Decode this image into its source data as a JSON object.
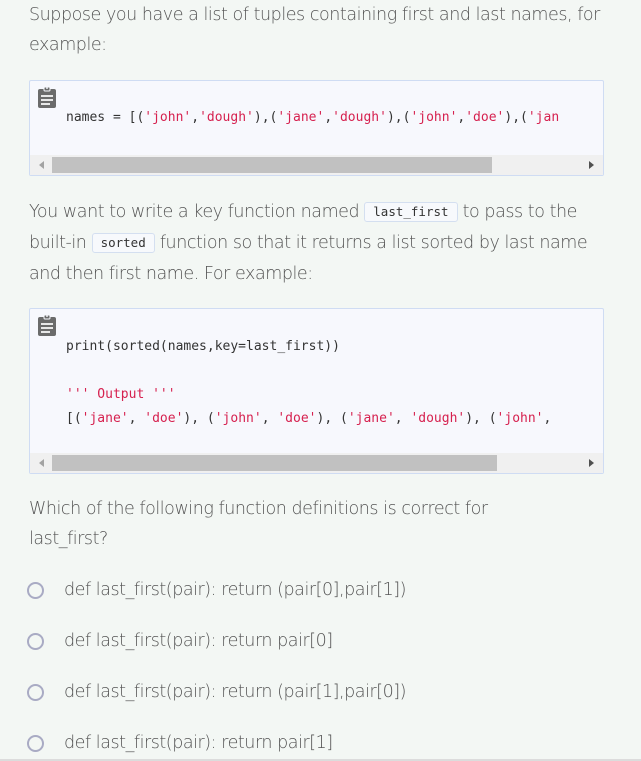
{
  "intro": {
    "text": "Suppose you have a list of tuples containing first and last names, for example:"
  },
  "code_block_1": {
    "icon": "clipboard-icon",
    "line_prefix": "names = [(",
    "tokens": [
      {
        "t": "'john'",
        "s": true
      },
      {
        "t": ",",
        "s": false
      },
      {
        "t": "'dough'",
        "s": true
      },
      {
        "t": "),(",
        "s": false
      },
      {
        "t": "'jane'",
        "s": true
      },
      {
        "t": ",",
        "s": false
      },
      {
        "t": "'dough'",
        "s": true
      },
      {
        "t": "),(",
        "s": false
      },
      {
        "t": "'john'",
        "s": true
      },
      {
        "t": ",",
        "s": false
      },
      {
        "t": "'doe'",
        "s": true
      },
      {
        "t": "),(",
        "s": false
      },
      {
        "t": "'jan",
        "s": true
      }
    ]
  },
  "description": {
    "part1": "You want to write a key function named ",
    "code1": "last_first",
    "part2": " to pass to the built-in ",
    "code2": "sorted",
    "part3": " function so that it returns a list sorted by last name and then first name. For example:"
  },
  "code_block_2": {
    "icon": "clipboard-icon",
    "line1": "print(sorted(names,key=last_first))",
    "line2": "''' Output '''",
    "line3_tokens": [
      {
        "t": "[(",
        "s": false
      },
      {
        "t": "'jane'",
        "s": true
      },
      {
        "t": ", ",
        "s": false
      },
      {
        "t": "'doe'",
        "s": true
      },
      {
        "t": "), (",
        "s": false
      },
      {
        "t": "'john'",
        "s": true
      },
      {
        "t": ", ",
        "s": false
      },
      {
        "t": "'doe'",
        "s": true
      },
      {
        "t": "), (",
        "s": false
      },
      {
        "t": "'jane'",
        "s": true
      },
      {
        "t": ", ",
        "s": false
      },
      {
        "t": "'dough'",
        "s": true
      },
      {
        "t": "), (",
        "s": false
      },
      {
        "t": "'john'",
        "s": true
      },
      {
        "t": ",",
        "s": false
      }
    ]
  },
  "question": {
    "text": "Which of the following function definitions is correct for last_first?"
  },
  "options": [
    {
      "label": "def last_first(pair): return (pair[0],pair[1])",
      "selected": false
    },
    {
      "label": "def last_first(pair): return pair[0]",
      "selected": false
    },
    {
      "label": "def last_first(pair): return (pair[1],pair[0])",
      "selected": false
    },
    {
      "label": "def last_first(pair): return pair[1]",
      "selected": false
    }
  ],
  "colors": {
    "string": "#d6214f",
    "text": "#555555",
    "code_bg": "#f7f8fd",
    "code_border": "#cfdcf3",
    "radio_border": "#a9abc4"
  }
}
